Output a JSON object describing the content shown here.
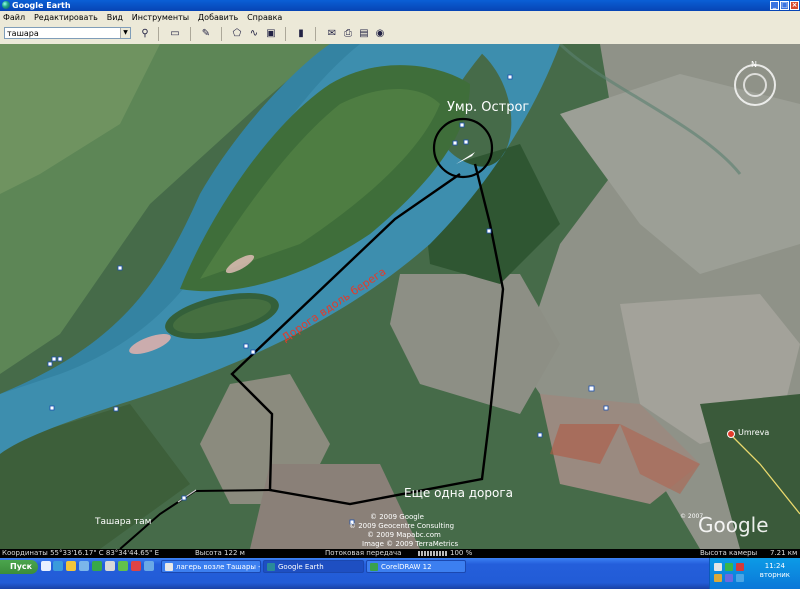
{
  "window": {
    "title": "Google Earth"
  },
  "menu": [
    "Файл",
    "Редактировать",
    "Вид",
    "Инструменты",
    "Добавить",
    "Справка"
  ],
  "search": {
    "value": "ташара"
  },
  "map": {
    "labels": {
      "ostrog": "Умр. Острог",
      "road_along_shore": "Дорога вдоль берега",
      "another_road": "Еще одна дорога",
      "tashara": "Ташара там",
      "umreva": "Umreva"
    },
    "copyright": [
      "© 2009 Google",
      "© 2009 Geocentre Consulting",
      "© 2009 Mapabc.com",
      "Image © 2009 TerraMetrics"
    ],
    "logo": "Google",
    "logo_year": "© 2007"
  },
  "status": {
    "coords": "Координаты  55°33'16.17\" С    83°34'44.65\" E",
    "altitude": "Высота  122 м",
    "stream": "Потоковая передача",
    "stream_pct": "100 %",
    "camera": "Высота камеры",
    "camera_alt": "7.21 км"
  },
  "taskbar": {
    "start": "Пуск",
    "tasks": [
      "лагерь возле Ташары - ...",
      "Google Earth",
      "CorelDRAW 12"
    ],
    "time": "11:24",
    "day": "вторник"
  },
  "colors": {
    "river": "#3d8eae",
    "road": "#000000",
    "label_red": "#e33b2a"
  }
}
